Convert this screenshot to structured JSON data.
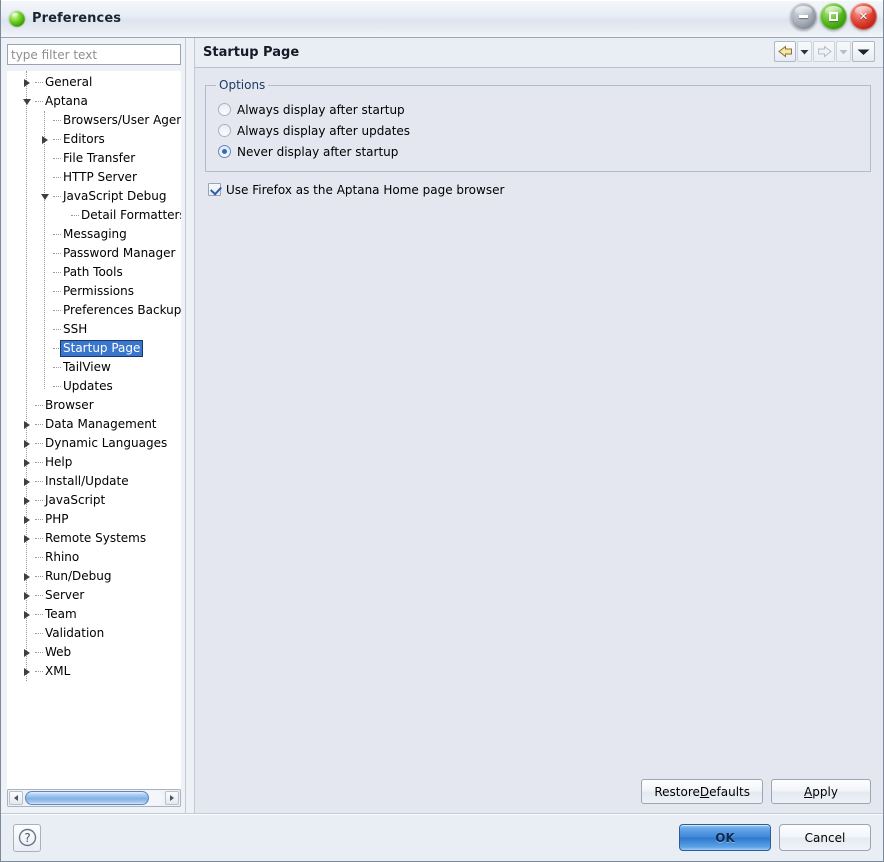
{
  "window": {
    "title": "Preferences",
    "icon": "green-sphere-icon",
    "buttons": {
      "minimize": "minimize-icon",
      "maximize": "maximize-icon",
      "close": "close-icon"
    }
  },
  "filter": {
    "placeholder": "type filter text",
    "value": ""
  },
  "tree": {
    "selected": "Startup Page",
    "items": [
      {
        "label": "General",
        "level": 0,
        "twisty": "collapsed"
      },
      {
        "label": "Aptana",
        "level": 0,
        "twisty": "expanded"
      },
      {
        "label": "Browsers/User Agents",
        "level": 1,
        "twisty": "leaf"
      },
      {
        "label": "Editors",
        "level": 1,
        "twisty": "collapsed"
      },
      {
        "label": "File Transfer",
        "level": 1,
        "twisty": "leaf"
      },
      {
        "label": "HTTP Server",
        "level": 1,
        "twisty": "leaf"
      },
      {
        "label": "JavaScript Debug",
        "level": 1,
        "twisty": "expanded"
      },
      {
        "label": "Detail Formatters",
        "level": 2,
        "twisty": "leaf"
      },
      {
        "label": "Messaging",
        "level": 1,
        "twisty": "leaf"
      },
      {
        "label": "Password Manager",
        "level": 1,
        "twisty": "leaf"
      },
      {
        "label": "Path Tools",
        "level": 1,
        "twisty": "leaf"
      },
      {
        "label": "Permissions",
        "level": 1,
        "twisty": "leaf"
      },
      {
        "label": "Preferences Backup",
        "level": 1,
        "twisty": "leaf"
      },
      {
        "label": "SSH",
        "level": 1,
        "twisty": "leaf"
      },
      {
        "label": "Startup Page",
        "level": 1,
        "twisty": "leaf",
        "selected": true
      },
      {
        "label": "TailView",
        "level": 1,
        "twisty": "leaf"
      },
      {
        "label": "Updates",
        "level": 1,
        "twisty": "leaf"
      },
      {
        "label": "Browser",
        "level": 0,
        "twisty": "leaf"
      },
      {
        "label": "Data Management",
        "level": 0,
        "twisty": "collapsed"
      },
      {
        "label": "Dynamic Languages",
        "level": 0,
        "twisty": "collapsed"
      },
      {
        "label": "Help",
        "level": 0,
        "twisty": "collapsed"
      },
      {
        "label": "Install/Update",
        "level": 0,
        "twisty": "collapsed"
      },
      {
        "label": "JavaScript",
        "level": 0,
        "twisty": "collapsed"
      },
      {
        "label": "PHP",
        "level": 0,
        "twisty": "collapsed"
      },
      {
        "label": "Remote Systems",
        "level": 0,
        "twisty": "collapsed"
      },
      {
        "label": "Rhino",
        "level": 0,
        "twisty": "leaf"
      },
      {
        "label": "Run/Debug",
        "level": 0,
        "twisty": "collapsed"
      },
      {
        "label": "Server",
        "level": 0,
        "twisty": "collapsed"
      },
      {
        "label": "Team",
        "level": 0,
        "twisty": "collapsed"
      },
      {
        "label": "Validation",
        "level": 0,
        "twisty": "leaf"
      },
      {
        "label": "Web",
        "level": 0,
        "twisty": "collapsed"
      },
      {
        "label": "XML",
        "level": 0,
        "twisty": "collapsed"
      }
    ]
  },
  "scrollbar": {
    "left_arrow": "arrow-left-icon",
    "right_arrow": "arrow-right-icon",
    "thumb_position": "0%"
  },
  "page": {
    "title": "Startup Page",
    "nav": {
      "back": "arrow-back-icon",
      "back_menu": "chevron-down-icon",
      "forward": "arrow-forward-icon",
      "forward_menu": "chevron-down-icon",
      "view_menu": "chevron-down-icon"
    },
    "options_group": {
      "legend": "Options",
      "radios": [
        {
          "label": "Always display after startup",
          "checked": false
        },
        {
          "label": "Always display after updates",
          "checked": false
        },
        {
          "label": "Never display after startup",
          "checked": true
        }
      ]
    },
    "checkbox": {
      "label": "Use Firefox as the Aptana Home page browser",
      "checked": true
    },
    "buttons": {
      "restore_defaults_pre": "Restore ",
      "restore_defaults_mnemonic": "D",
      "restore_defaults_post": "efaults",
      "apply_mnemonic": "A",
      "apply_post": "pply"
    }
  },
  "bottom": {
    "help": "?",
    "ok": "OK",
    "cancel": "Cancel"
  },
  "colors": {
    "selection_blue": "#3a76cc",
    "content_bg": "#e4e7f0",
    "chrome_bg": "#e9edf4",
    "ok_blue": "#3f87d8",
    "group_legend": "#1e3a66",
    "accent_check": "#2a5fa8"
  }
}
